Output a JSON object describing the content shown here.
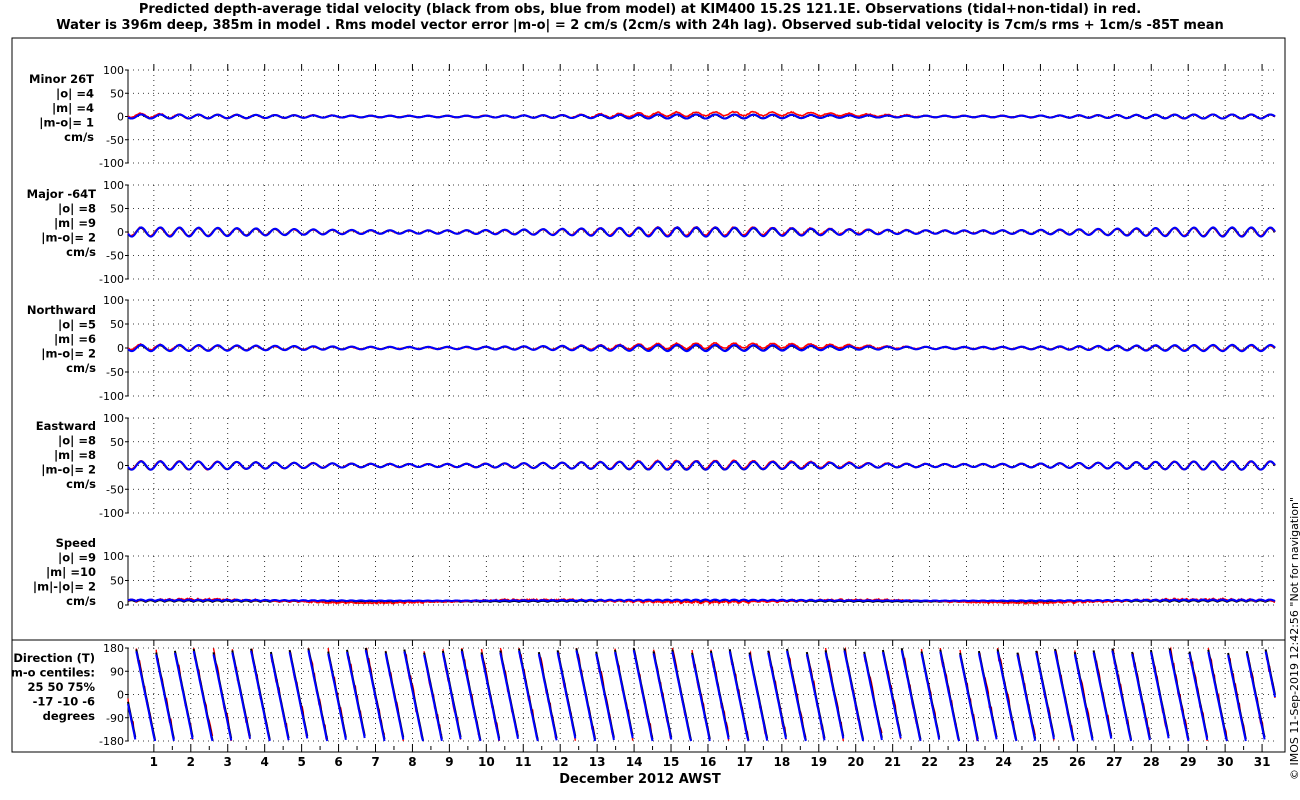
{
  "title": {
    "line1": "Predicted depth-average tidal velocity (black from obs, blue from model) at KIM400 15.2S 121.1E. Observations (tidal+non-tidal) in red.",
    "line2": "Water is 396m deep, 385m in model . Rms model vector error |m-o| = 2 cm/s (2cm/s with 24h lag). Observed sub-tidal velocity is 7cm/s rms + 1cm/s -85T mean"
  },
  "credit": "© IMOS 11-Sep-2019 12:42:56  \"Not for navigation\"",
  "colors": {
    "observed_tidal": "#000000",
    "model": "#0000ff",
    "observations": "#ff0000"
  },
  "panels": [
    {
      "name": "minor",
      "label_lines": [
        "Minor 26T",
        "|o| =4",
        "|m| =4",
        "|m-o|= 1",
        "cm/s"
      ]
    },
    {
      "name": "major",
      "label_lines": [
        "Major -64T",
        "|o| =8",
        "|m| =9",
        "|m-o|= 2",
        "cm/s"
      ]
    },
    {
      "name": "northward",
      "label_lines": [
        "Northward",
        "|o| =5",
        "|m| =6",
        "|m-o|= 2",
        "cm/s"
      ]
    },
    {
      "name": "eastward",
      "label_lines": [
        "Eastward",
        "|o| =8",
        "|m| =8",
        "|m-o|= 2",
        "cm/s"
      ]
    },
    {
      "name": "speed",
      "label_lines": [
        "Speed",
        "|o| =9",
        "|m| =10",
        "|m|-|o|= 2",
        "cm/s"
      ]
    },
    {
      "name": "direction",
      "label_lines": [
        "Direction (T)",
        "m-o centiles:",
        "25  50  75%",
        "-17  -10  -6",
        "degrees"
      ]
    }
  ],
  "chart_data": {
    "type": "line",
    "xlabel": "December 2012 AWST",
    "x_ticks": [
      "1",
      "2",
      "3",
      "4",
      "5",
      "6",
      "7",
      "8",
      "9",
      "10",
      "11",
      "12",
      "13",
      "14",
      "15",
      "16",
      "17",
      "18",
      "19",
      "20",
      "21",
      "22",
      "23",
      "24",
      "25",
      "26",
      "27",
      "28",
      "29",
      "30",
      "31"
    ],
    "xlim_days": [
      0.3,
      31.35
    ],
    "series_names": [],
    "panels": [
      {
        "name": "Minor 26T",
        "ylim": [
          -100,
          100
        ],
        "yticks": [
          100,
          50,
          0,
          -50,
          -100
        ],
        "amp_obs": 4,
        "amp_model": 4,
        "subtidal_drift": 6
      },
      {
        "name": "Major -64T",
        "ylim": [
          -100,
          100
        ],
        "yticks": [
          100,
          50,
          0,
          -50,
          -100
        ],
        "amp_obs": 8,
        "amp_model": 9,
        "subtidal_drift": 2
      },
      {
        "name": "Northward",
        "ylim": [
          -100,
          100
        ],
        "yticks": [
          100,
          50,
          0,
          -50,
          -100
        ],
        "amp_obs": 5,
        "amp_model": 6,
        "subtidal_drift": 5
      },
      {
        "name": "Eastward",
        "ylim": [
          -100,
          100
        ],
        "yticks": [
          100,
          50,
          0,
          -50,
          -100
        ],
        "amp_obs": 8,
        "amp_model": 8,
        "subtidal_drift": 2
      },
      {
        "name": "Speed",
        "ylim": [
          0,
          100
        ],
        "yticks": [
          100,
          50,
          0
        ],
        "amp_obs": 9,
        "amp_model": 10,
        "subtidal_drift": 3
      },
      {
        "name": "Direction (T)",
        "ylim": [
          -180,
          180
        ],
        "yticks": [
          180,
          90,
          0,
          -90,
          -180
        ],
        "cycles_per_day": 1.93
      }
    ]
  }
}
